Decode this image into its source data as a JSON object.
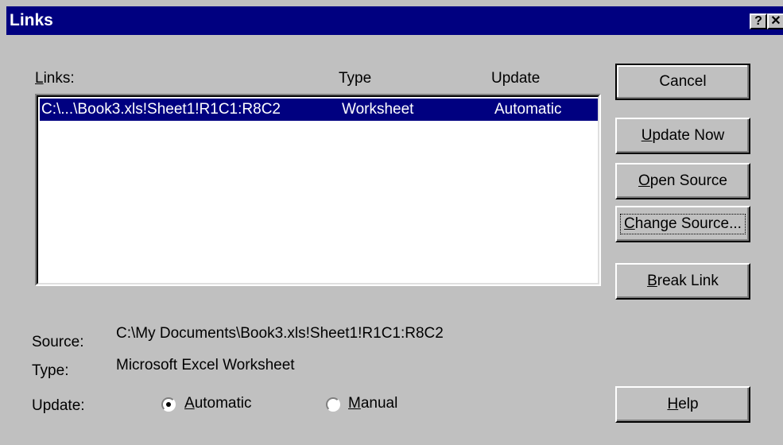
{
  "window": {
    "title": "Links",
    "help_glyph": "?",
    "close_glyph": "✕"
  },
  "list": {
    "label": "Links:",
    "columns": {
      "link": "Links:",
      "type": "Type",
      "update": "Update"
    },
    "rows": [
      {
        "link": "C:\\...\\Book3.xls!Sheet1!R1C1:R8C2",
        "type": "Worksheet",
        "update": "Automatic",
        "selected": true
      }
    ]
  },
  "buttons": {
    "cancel": "Cancel",
    "update_now": "Update Now",
    "open_source": "Open Source",
    "change_source": "Change Source...",
    "break_link": "Break Link",
    "help": "Help"
  },
  "details": {
    "source_label": "Source:",
    "source_value": "C:\\My Documents\\Book3.xls!Sheet1!R1C1:R8C2",
    "type_label": "Type:",
    "type_value": "Microsoft Excel Worksheet",
    "update_label": "Update:",
    "options": [
      {
        "label": "Automatic",
        "selected": true
      },
      {
        "label": "Manual",
        "selected": false
      }
    ]
  },
  "colors": {
    "title_bar": "#000080",
    "face": "#c0c0c0",
    "selection": "#000080"
  }
}
